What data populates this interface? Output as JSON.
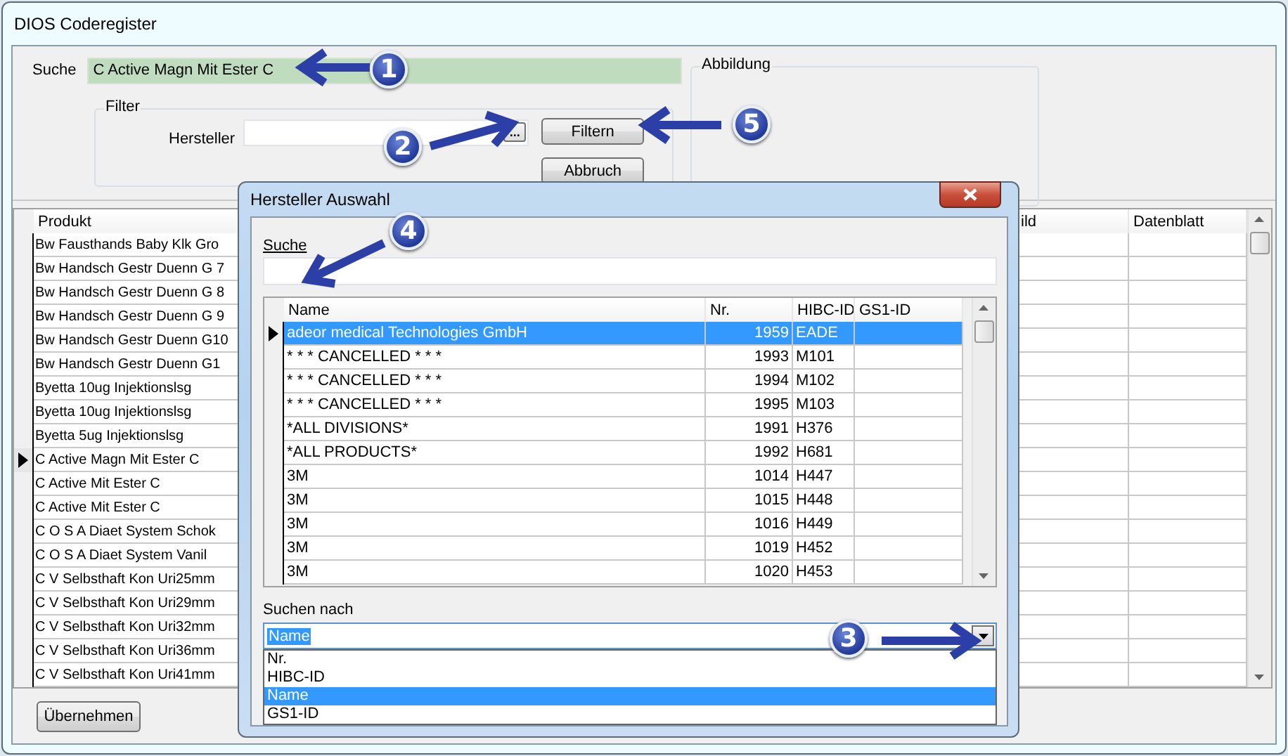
{
  "window": {
    "title": "DIOS Coderegister"
  },
  "search": {
    "label": "Suche",
    "value": "C Active Magn Mit Ester C"
  },
  "filter": {
    "legend": "Filter",
    "manufacturer_label": "Hersteller",
    "browse_button": "...",
    "buttons": [
      "Filtern",
      "Abbruch"
    ]
  },
  "image_group": {
    "legend": "Abbildung"
  },
  "table": {
    "columns": [
      "Produkt",
      "ild",
      "Datenblatt"
    ],
    "rows": [
      {
        "produkt": "Bw Fausthands Baby Klk Gro",
        "selected": false
      },
      {
        "produkt": "Bw Handsch Gestr Duenn G 7",
        "selected": false
      },
      {
        "produkt": "Bw Handsch Gestr Duenn G 8",
        "selected": false
      },
      {
        "produkt": "Bw Handsch Gestr Duenn G 9",
        "selected": false
      },
      {
        "produkt": "Bw Handsch Gestr Duenn G10",
        "selected": false
      },
      {
        "produkt": "Bw Handsch Gestr Duenn G1",
        "selected": false
      },
      {
        "produkt": "Byetta 10ug Injektionslsg",
        "selected": false
      },
      {
        "produkt": "Byetta 10ug Injektionslsg",
        "selected": false
      },
      {
        "produkt": "Byetta 5ug Injektionslsg",
        "selected": false
      },
      {
        "produkt": "C Active Magn Mit Ester C",
        "selected": true
      },
      {
        "produkt": "C Active Mit Ester C",
        "selected": false
      },
      {
        "produkt": "C Active Mit Ester C",
        "selected": false
      },
      {
        "produkt": "C O S A Diaet System Schok",
        "selected": false
      },
      {
        "produkt": "C O S A Diaet System Vanil",
        "selected": false
      },
      {
        "produkt": "C V Selbsthaft Kon Uri25mm",
        "selected": false
      },
      {
        "produkt": "C V Selbsthaft Kon Uri29mm",
        "selected": false
      },
      {
        "produkt": "C V Selbsthaft Kon Uri32mm",
        "selected": false
      },
      {
        "produkt": "C V Selbsthaft Kon Uri36mm",
        "selected": false
      },
      {
        "produkt": "C V Selbsthaft Kon Uri41mm",
        "selected": false
      }
    ]
  },
  "apply_button": "Übernehmen",
  "dialog": {
    "title": "Hersteller Auswahl",
    "search_label": "Suche",
    "columns": [
      "Name",
      "Nr.",
      "HIBC-ID",
      "GS1-ID"
    ],
    "rows": [
      {
        "name": "adeor medical Technologies GmbH",
        "nr": "1959",
        "hibc": "EADE",
        "selected": true
      },
      {
        "name": "* * * CANCELLED * * *",
        "nr": "1993",
        "hibc": "M101",
        "selected": false
      },
      {
        "name": "* * * CANCELLED * * *",
        "nr": "1994",
        "hibc": "M102",
        "selected": false
      },
      {
        "name": "* * * CANCELLED * * *",
        "nr": "1995",
        "hibc": "M103",
        "selected": false
      },
      {
        "name": "*ALL DIVISIONS*",
        "nr": "1991",
        "hibc": "H376",
        "selected": false
      },
      {
        "name": "*ALL PRODUCTS*",
        "nr": "1992",
        "hibc": "H681",
        "selected": false
      },
      {
        "name": "3M",
        "nr": "1014",
        "hibc": "H447",
        "selected": false
      },
      {
        "name": "3M",
        "nr": "1015",
        "hibc": "H448",
        "selected": false
      },
      {
        "name": "3M",
        "nr": "1016",
        "hibc": "H449",
        "selected": false
      },
      {
        "name": "3M",
        "nr": "1019",
        "hibc": "H452",
        "selected": false
      },
      {
        "name": "3M",
        "nr": "1020",
        "hibc": "H453",
        "selected": false
      }
    ],
    "search_by_label": "Suchen nach",
    "search_by_value": "Name",
    "search_by_options": [
      {
        "label": "Nr.",
        "selected": false
      },
      {
        "label": "HIBC-ID",
        "selected": false
      },
      {
        "label": "Name",
        "selected": true
      },
      {
        "label": "GS1-ID",
        "selected": false
      }
    ]
  },
  "callouts": [
    "1",
    "2",
    "3",
    "4",
    "5"
  ]
}
